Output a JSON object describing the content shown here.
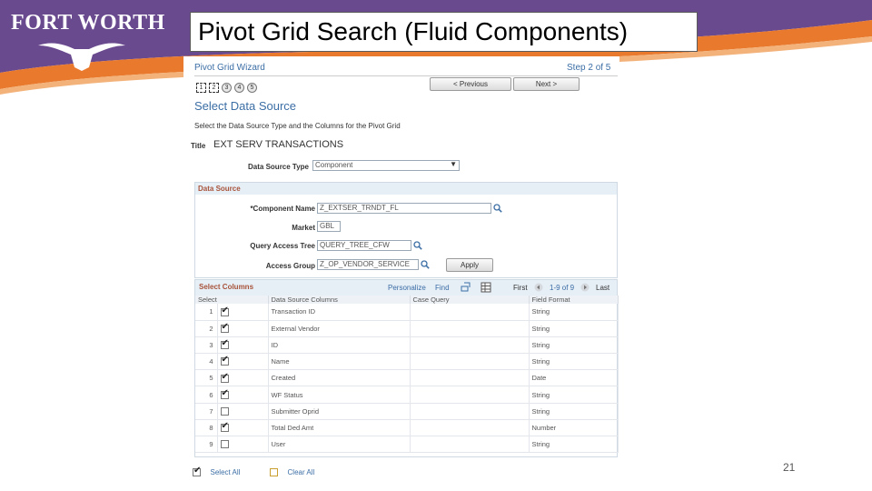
{
  "logo": {
    "text": "FORT WORTH"
  },
  "slide": {
    "title": "Pivot Grid Search (Fluid Components)",
    "page_number": "21"
  },
  "colors": {
    "purple": "#6a4a8f",
    "orange": "#e8792d",
    "link_blue": "#3b6ea5",
    "section_rust": "#a8543b"
  },
  "wizard": {
    "title": "Pivot Grid Wizard",
    "step_text": "Step 2 of 5",
    "steps": [
      "1",
      "2",
      "3",
      "4",
      "5"
    ],
    "active_step": 2,
    "previous_label": "< Previous",
    "next_label": "Next >",
    "section_title": "Select Data Source",
    "instructions": "Select the Data Source Type and the Columns for the Pivot Grid",
    "title_label": "Title",
    "title_value": "EXT SERV TRANSACTIONS",
    "source_type_label": "Data Source Type",
    "source_type_value": "Component"
  },
  "data_source": {
    "heading": "Data Source",
    "component_label": "*Component Name",
    "component_value": "Z_EXTSER_TRNDT_FL",
    "market_label": "Market",
    "market_value": "GBL",
    "query_tree_label": "Query Access Tree",
    "query_tree_value": "QUERY_TREE_CFW",
    "access_group_label": "Access Group",
    "access_group_value": "Z_OP_VENDOR_SERVICE",
    "apply_label": "Apply"
  },
  "select_columns": {
    "heading": "Select Columns",
    "personalize": "Personalize",
    "find": "Find",
    "first": "First",
    "range": "1-9 of 9",
    "last": "Last",
    "headers": [
      "Select",
      "Data Source Columns",
      "Case Query",
      "Field Format"
    ],
    "rows": [
      {
        "num": "1",
        "checked": true,
        "column": "Transaction ID",
        "case": "",
        "format": "String"
      },
      {
        "num": "2",
        "checked": true,
        "column": "External Vendor",
        "case": "",
        "format": "String"
      },
      {
        "num": "3",
        "checked": true,
        "column": "ID",
        "case": "",
        "format": "String"
      },
      {
        "num": "4",
        "checked": true,
        "column": "Name",
        "case": "",
        "format": "String"
      },
      {
        "num": "5",
        "checked": true,
        "column": "Created",
        "case": "",
        "format": "Date"
      },
      {
        "num": "6",
        "checked": true,
        "column": "WF Status",
        "case": "",
        "format": "String"
      },
      {
        "num": "7",
        "checked": false,
        "column": "Submitter Oprid",
        "case": "",
        "format": "String"
      },
      {
        "num": "8",
        "checked": true,
        "column": "Total Ded Amt",
        "case": "",
        "format": "Number"
      },
      {
        "num": "9",
        "checked": false,
        "column": "User",
        "case": "",
        "format": "String"
      }
    ],
    "select_all": "Select All",
    "clear_all": "Clear All"
  }
}
